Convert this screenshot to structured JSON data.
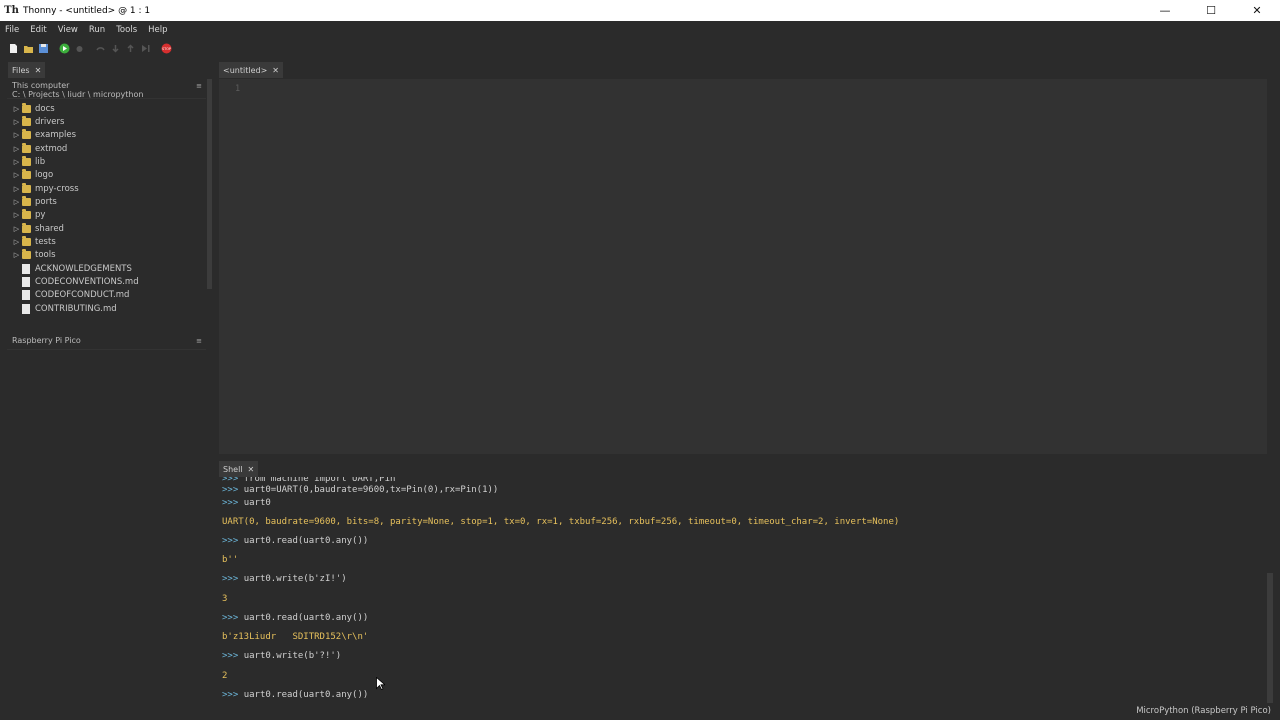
{
  "window": {
    "title": "Thonny  -  <untitled>  @  1 : 1",
    "app_icon": "Th"
  },
  "menu": [
    "File",
    "Edit",
    "View",
    "Run",
    "Tools",
    "Help"
  ],
  "toolbar": {
    "icons": [
      "new-file-icon",
      "open-icon",
      "save-icon",
      "run-icon",
      "debug-icon",
      "step-over-icon",
      "step-into-icon",
      "step-out-icon",
      "resume-icon",
      "stop-icon"
    ],
    "stop_label": "STOP",
    "colors": {
      "run": "#3cae3c",
      "stop": "#d62f2f"
    }
  },
  "files_panel": {
    "tab_label": "Files",
    "location_label": "This computer",
    "path": "C: \\ Projects \\ liudr \\ micropython",
    "folders": [
      "docs",
      "drivers",
      "examples",
      "extmod",
      "lib",
      "logo",
      "mpy-cross",
      "ports",
      "py",
      "shared",
      "tests",
      "tools"
    ],
    "files": [
      "ACKNOWLEDGEMENTS",
      "CODECONVENTIONS.md",
      "CODEOFCONDUCT.md",
      "CONTRIBUTING.md"
    ]
  },
  "device_panel": {
    "title": "Raspberry Pi Pico"
  },
  "editor": {
    "tab_label": "<untitled>",
    "line_number": "1"
  },
  "shell": {
    "tab_label": "Shell",
    "prompt": ">>>",
    "lines": [
      {
        "kind": "input",
        "text": "from machine import UART,Pin"
      },
      {
        "kind": "input",
        "text": "uart0=UART(0,baudrate=9600,tx=Pin(0),rx=Pin(1))"
      },
      {
        "kind": "input",
        "text": "uart0"
      },
      {
        "kind": "output",
        "text": "UART(0, baudrate=9600, bits=8, parity=None, stop=1, tx=0, rx=1, txbuf=256, rxbuf=256, timeout=0, timeout_char=2, invert=None)"
      },
      {
        "kind": "input",
        "text": "uart0.read(uart0.any())"
      },
      {
        "kind": "output",
        "text": "b''"
      },
      {
        "kind": "input",
        "text": "uart0.write(b'zI!')"
      },
      {
        "kind": "output",
        "text": "3"
      },
      {
        "kind": "input",
        "text": "uart0.read(uart0.any())"
      },
      {
        "kind": "output",
        "text": "b'z13Liudr   SDITRD152\\r\\n'"
      },
      {
        "kind": "input",
        "text": "uart0.write(b'?!')"
      },
      {
        "kind": "output",
        "text": "2"
      },
      {
        "kind": "input",
        "text": "uart0.read(uart0.any())"
      }
    ]
  },
  "status_bar": {
    "interpreter": "MicroPython (Raspberry Pi Pico)"
  }
}
